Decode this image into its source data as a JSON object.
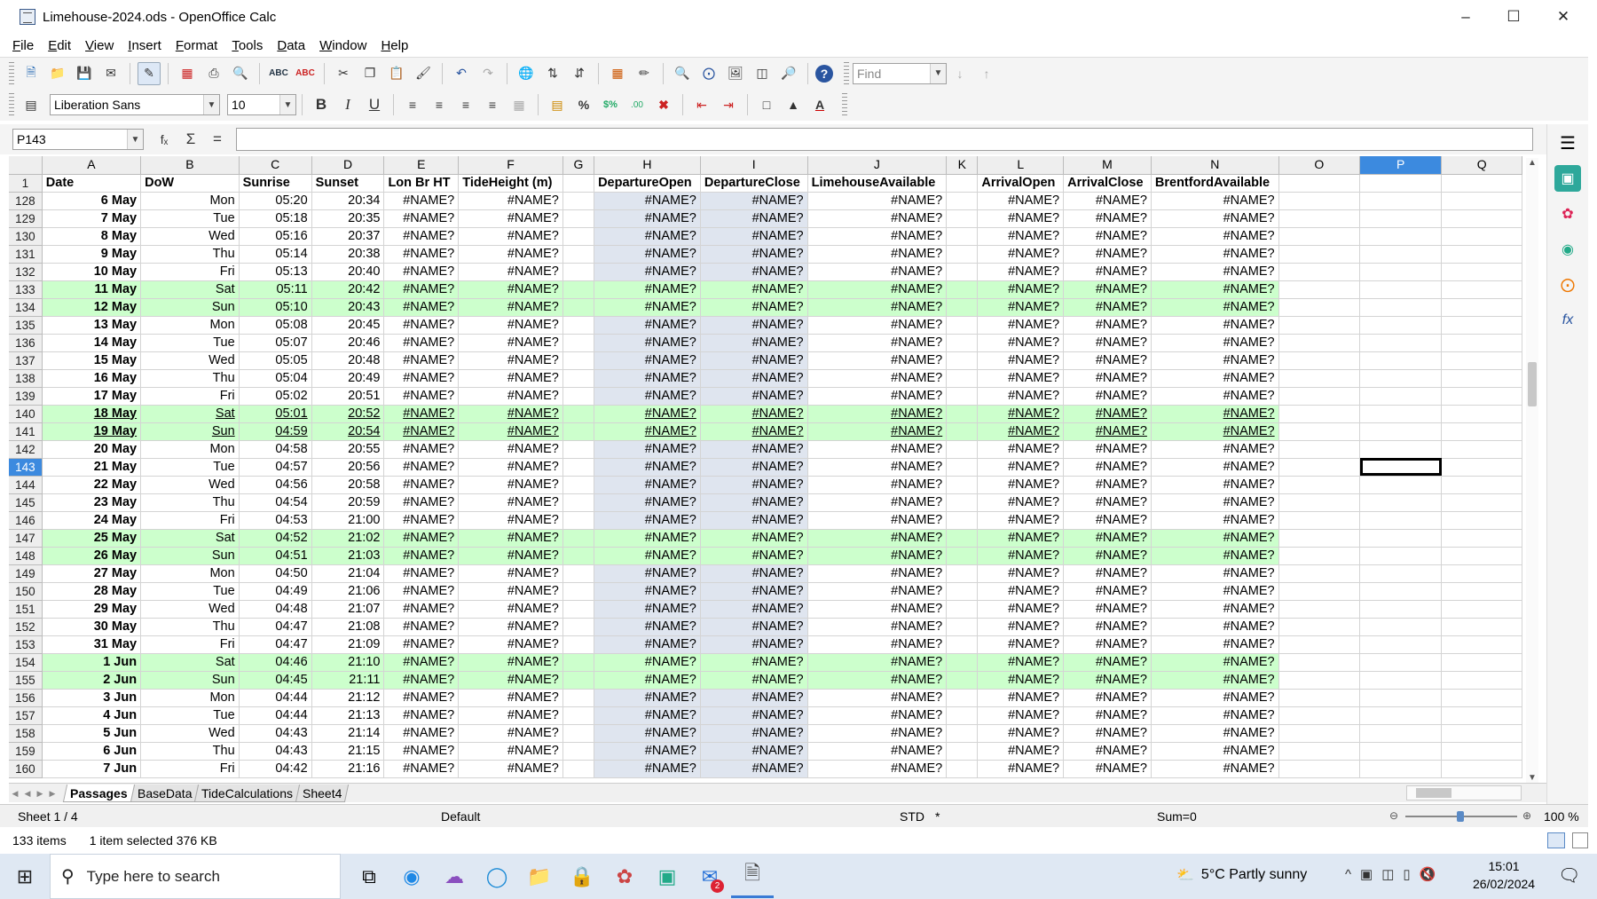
{
  "window": {
    "title": "Limehouse-2024.ods - OpenOffice Calc"
  },
  "menu": [
    "File",
    "Edit",
    "View",
    "Insert",
    "Format",
    "Tools",
    "Data",
    "Window",
    "Help"
  ],
  "toolbar": {
    "find_placeholder": "Find",
    "font_name": "Liberation Sans",
    "font_size": "10"
  },
  "formula": {
    "cell_ref": "P143",
    "value": ""
  },
  "columns": [
    "A",
    "B",
    "C",
    "D",
    "E",
    "F",
    "G",
    "H",
    "I",
    "J",
    "K",
    "L",
    "M",
    "N",
    "O",
    "P",
    "Q"
  ],
  "selected_column": "P",
  "header_row": {
    "num": "1",
    "cells": [
      "Date",
      "DoW",
      "Sunrise",
      "Sunset",
      "Lon Br HT",
      "TideHeight (m)",
      "",
      "DepartureOpen",
      "DepartureClose",
      "LimehouseAvailable",
      "",
      "ArrivalOpen",
      "ArrivalClose",
      "BrentfordAvailable",
      "",
      "",
      ""
    ]
  },
  "rows": [
    {
      "num": "128",
      "date": "6 May",
      "dow": "Mon",
      "sunrise": "05:20",
      "sunset": "20:34",
      "weekend": false
    },
    {
      "num": "129",
      "date": "7 May",
      "dow": "Tue",
      "sunrise": "05:18",
      "sunset": "20:35",
      "weekend": false
    },
    {
      "num": "130",
      "date": "8 May",
      "dow": "Wed",
      "sunrise": "05:16",
      "sunset": "20:37",
      "weekend": false
    },
    {
      "num": "131",
      "date": "9 May",
      "dow": "Thu",
      "sunrise": "05:14",
      "sunset": "20:38",
      "weekend": false
    },
    {
      "num": "132",
      "date": "10 May",
      "dow": "Fri",
      "sunrise": "05:13",
      "sunset": "20:40",
      "weekend": false
    },
    {
      "num": "133",
      "date": "11 May",
      "dow": "Sat",
      "sunrise": "05:11",
      "sunset": "20:42",
      "weekend": true
    },
    {
      "num": "134",
      "date": "12 May",
      "dow": "Sun",
      "sunrise": "05:10",
      "sunset": "20:43",
      "weekend": true
    },
    {
      "num": "135",
      "date": "13 May",
      "dow": "Mon",
      "sunrise": "05:08",
      "sunset": "20:45",
      "weekend": false
    },
    {
      "num": "136",
      "date": "14 May",
      "dow": "Tue",
      "sunrise": "05:07",
      "sunset": "20:46",
      "weekend": false
    },
    {
      "num": "137",
      "date": "15 May",
      "dow": "Wed",
      "sunrise": "05:05",
      "sunset": "20:48",
      "weekend": false
    },
    {
      "num": "138",
      "date": "16 May",
      "dow": "Thu",
      "sunrise": "05:04",
      "sunset": "20:49",
      "weekend": false
    },
    {
      "num": "139",
      "date": "17 May",
      "dow": "Fri",
      "sunrise": "05:02",
      "sunset": "20:51",
      "weekend": false
    },
    {
      "num": "140",
      "date": "18 May",
      "dow": "Sat",
      "sunrise": "05:01",
      "sunset": "20:52",
      "weekend": true,
      "underline": true
    },
    {
      "num": "141",
      "date": "19 May",
      "dow": "Sun",
      "sunrise": "04:59",
      "sunset": "20:54",
      "weekend": true,
      "underline": true
    },
    {
      "num": "142",
      "date": "20 May",
      "dow": "Mon",
      "sunrise": "04:58",
      "sunset": "20:55",
      "weekend": false
    },
    {
      "num": "143",
      "date": "21 May",
      "dow": "Tue",
      "sunrise": "04:57",
      "sunset": "20:56",
      "weekend": false
    },
    {
      "num": "144",
      "date": "22 May",
      "dow": "Wed",
      "sunrise": "04:56",
      "sunset": "20:58",
      "weekend": false
    },
    {
      "num": "145",
      "date": "23 May",
      "dow": "Thu",
      "sunrise": "04:54",
      "sunset": "20:59",
      "weekend": false
    },
    {
      "num": "146",
      "date": "24 May",
      "dow": "Fri",
      "sunrise": "04:53",
      "sunset": "21:00",
      "weekend": false
    },
    {
      "num": "147",
      "date": "25 May",
      "dow": "Sat",
      "sunrise": "04:52",
      "sunset": "21:02",
      "weekend": true
    },
    {
      "num": "148",
      "date": "26 May",
      "dow": "Sun",
      "sunrise": "04:51",
      "sunset": "21:03",
      "weekend": true
    },
    {
      "num": "149",
      "date": "27 May",
      "dow": "Mon",
      "sunrise": "04:50",
      "sunset": "21:04",
      "weekend": false
    },
    {
      "num": "150",
      "date": "28 May",
      "dow": "Tue",
      "sunrise": "04:49",
      "sunset": "21:06",
      "weekend": false
    },
    {
      "num": "151",
      "date": "29 May",
      "dow": "Wed",
      "sunrise": "04:48",
      "sunset": "21:07",
      "weekend": false
    },
    {
      "num": "152",
      "date": "30 May",
      "dow": "Thu",
      "sunrise": "04:47",
      "sunset": "21:08",
      "weekend": false
    },
    {
      "num": "153",
      "date": "31 May",
      "dow": "Fri",
      "sunrise": "04:47",
      "sunset": "21:09",
      "weekend": false
    },
    {
      "num": "154",
      "date": "1 Jun",
      "dow": "Sat",
      "sunrise": "04:46",
      "sunset": "21:10",
      "weekend": true
    },
    {
      "num": "155",
      "date": "2 Jun",
      "dow": "Sun",
      "sunrise": "04:45",
      "sunset": "21:11",
      "weekend": true
    },
    {
      "num": "156",
      "date": "3 Jun",
      "dow": "Mon",
      "sunrise": "04:44",
      "sunset": "21:12",
      "weekend": false
    },
    {
      "num": "157",
      "date": "4 Jun",
      "dow": "Tue",
      "sunrise": "04:44",
      "sunset": "21:13",
      "weekend": false
    },
    {
      "num": "158",
      "date": "5 Jun",
      "dow": "Wed",
      "sunrise": "04:43",
      "sunset": "21:14",
      "weekend": false
    },
    {
      "num": "159",
      "date": "6 Jun",
      "dow": "Thu",
      "sunrise": "04:43",
      "sunset": "21:15",
      "weekend": false
    },
    {
      "num": "160",
      "date": "7 Jun",
      "dow": "Fri",
      "sunrise": "04:42",
      "sunset": "21:16",
      "weekend": false
    }
  ],
  "error_value": "#NAME?",
  "active_row": "143",
  "sheet_tabs": [
    "Passages",
    "BaseData",
    "TideCalculations",
    "Sheet4"
  ],
  "active_tab": "Passages",
  "status": {
    "sheet": "Sheet 1 / 4",
    "style": "Default",
    "mode": "STD",
    "modified": "*",
    "sum": "Sum=0",
    "zoom": "100 %"
  },
  "explorer": {
    "items": "133 items",
    "selected": "1 item selected  376 KB"
  },
  "taskbar": {
    "search_placeholder": "Type here to search",
    "weather": "5°C  Partly sunny",
    "time": "15:01",
    "date": "26/02/2024",
    "notifications": "2"
  },
  "colors": {
    "weekend": "#ccffcc",
    "shaded": "#dfe5ef",
    "selection": "#3c8adf"
  }
}
